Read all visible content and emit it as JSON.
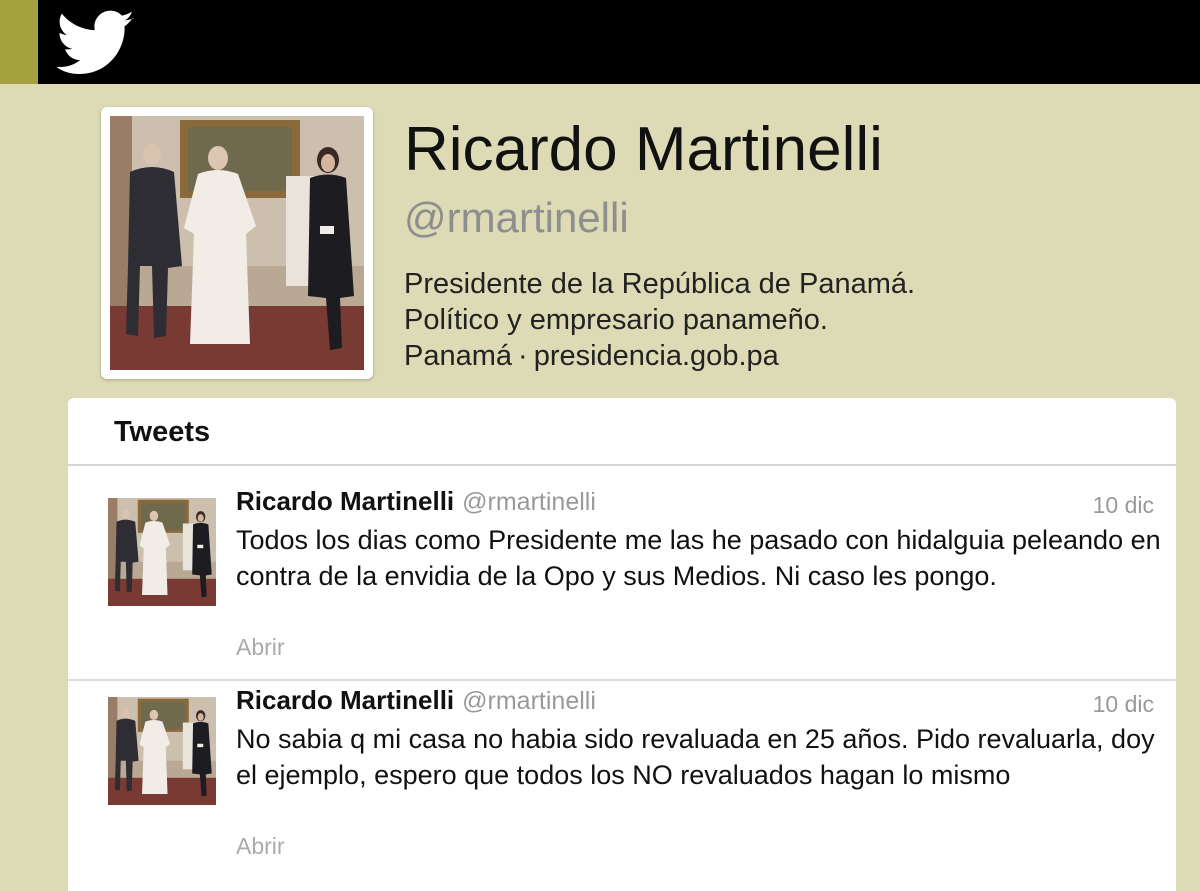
{
  "profile": {
    "name": "Ricardo Martinelli",
    "handle": "@rmartinelli",
    "bio_line1": "Presidente de la República de Panamá.",
    "bio_line2": "Político y empresario panameño.",
    "location": "Panamá",
    "separator": "·",
    "website": "presidencia.gob.pa"
  },
  "timeline": {
    "title": "Tweets",
    "tweets": [
      {
        "author": "Ricardo Martinelli",
        "handle": "@rmartinelli",
        "date": "10 dic",
        "text": "Todos los dias como Presidente me las he pasado con hidalguia peleando en contra de la envidia de la Opo y sus Medios. Ni caso les pongo.",
        "action": "Abrir"
      },
      {
        "author": "Ricardo Martinelli",
        "handle": "@rmartinelli",
        "date": "10 dic",
        "text": "No sabia q mi casa no habia sido revaluada en 25 años. Pido revaluarla, doy el ejemplo, espero que todos los NO revaluados hagan lo mismo",
        "action": "Abrir"
      }
    ]
  },
  "icons": {
    "logo": "twitter-bird-icon"
  },
  "colors": {
    "background": "#dcdbb5",
    "topbar": "#000000",
    "accent": "#a3a23f",
    "handle_gray": "#8e8e8e"
  }
}
